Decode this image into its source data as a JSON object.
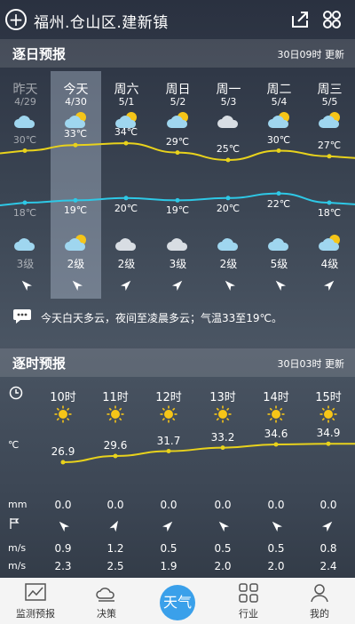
{
  "header": {
    "location": "福州.仓山区.建新镇"
  },
  "daily": {
    "title": "逐日预报",
    "updated": "30日09时 更新",
    "days": [
      {
        "name": "昨天",
        "date": "4/29",
        "high": "30℃",
        "low": "18℃",
        "wind": "3级"
      },
      {
        "name": "今天",
        "date": "4/30",
        "high": "33℃",
        "low": "19℃",
        "wind": "2级"
      },
      {
        "name": "周六",
        "date": "5/1",
        "high": "34℃",
        "low": "20℃",
        "wind": "2级"
      },
      {
        "name": "周日",
        "date": "5/2",
        "high": "29℃",
        "low": "19℃",
        "wind": "3级"
      },
      {
        "name": "周一",
        "date": "5/3",
        "high": "25℃",
        "low": "20℃",
        "wind": "2级"
      },
      {
        "name": "周二",
        "date": "5/4",
        "high": "30℃",
        "low": "22℃",
        "wind": "5级"
      },
      {
        "name": "周三",
        "date": "5/5",
        "high": "27℃",
        "low": "18℃",
        "wind": "4级"
      }
    ],
    "summary": "今天白天多云，夜间至凌晨多云；气温33至19℃。"
  },
  "hourly": {
    "title": "逐时预报",
    "updated": "30日03时 更新",
    "unit_temp": "℃",
    "unit_rain": "mm",
    "unit_speed1": "m/s",
    "unit_speed2": "m/s",
    "hours": [
      {
        "name": "10时",
        "temp": "26.9",
        "rain": "0.0",
        "speed": "0.9",
        "speed2": "2.3"
      },
      {
        "name": "11时",
        "temp": "29.6",
        "rain": "0.0",
        "speed": "1.2",
        "speed2": "2.5"
      },
      {
        "name": "12时",
        "temp": "31.7",
        "rain": "0.0",
        "speed": "0.5",
        "speed2": "1.9"
      },
      {
        "name": "13时",
        "temp": "33.2",
        "rain": "0.0",
        "speed": "0.5",
        "speed2": "2.0"
      },
      {
        "name": "14时",
        "temp": "34.6",
        "rain": "0.0",
        "speed": "0.5",
        "speed2": "2.0"
      },
      {
        "name": "15时",
        "temp": "34.9",
        "rain": "0.0",
        "speed": "0.8",
        "speed2": "2.4"
      }
    ]
  },
  "tabs": [
    {
      "label": "监测预报",
      "icon": "chart-icon"
    },
    {
      "label": "决策",
      "icon": "decision-icon"
    },
    {
      "label": "天气",
      "icon": "weather-icon"
    },
    {
      "label": "行业",
      "icon": "grid-icon"
    },
    {
      "label": "我的",
      "icon": "person-icon"
    }
  ],
  "colors": {
    "high_line": "#e8d21c",
    "low_line": "#2ec8e6",
    "tab_active": "#3aa0ea"
  }
}
